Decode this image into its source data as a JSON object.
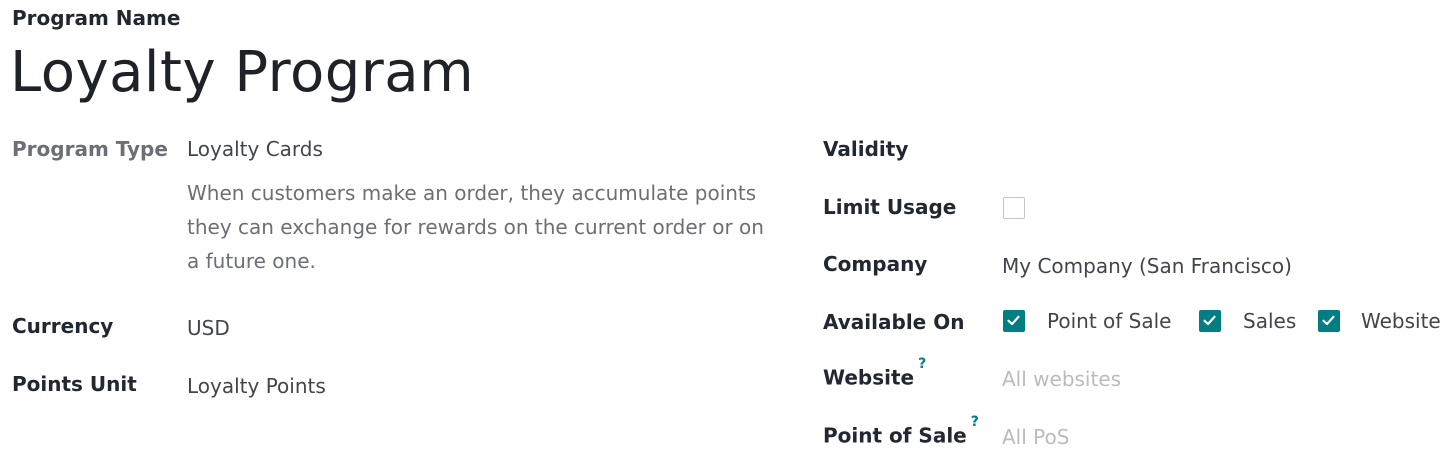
{
  "program_name_label": "Program Name",
  "program_name_value": "Loyalty Program",
  "left": {
    "program_type": {
      "label": "Program Type",
      "value": "Loyalty Cards",
      "description": "When customers make an order, they accumulate points they can exchange for rewards on the current order or on a future one."
    },
    "currency": {
      "label": "Currency",
      "value": "USD"
    },
    "points_unit": {
      "label": "Points Unit",
      "value": "Loyalty Points"
    }
  },
  "right": {
    "validity": {
      "label": "Validity"
    },
    "limit_usage": {
      "label": "Limit Usage",
      "checked": false
    },
    "company": {
      "label": "Company",
      "value": "My Company (San Francisco)"
    },
    "available_on": {
      "label": "Available On",
      "options": [
        {
          "label": "Point of Sale",
          "checked": true
        },
        {
          "label": "Sales",
          "checked": true
        },
        {
          "label": "Website",
          "checked": true
        }
      ]
    },
    "website": {
      "label": "Website",
      "help": "?",
      "placeholder": "All websites"
    },
    "point_of_sale": {
      "label": "Point of Sale",
      "help": "?",
      "placeholder": "All PoS"
    }
  },
  "colors": {
    "accent": "#017e84",
    "label": "#222831",
    "muted": "#6b6f76",
    "placeholder": "#b8bcc2"
  }
}
